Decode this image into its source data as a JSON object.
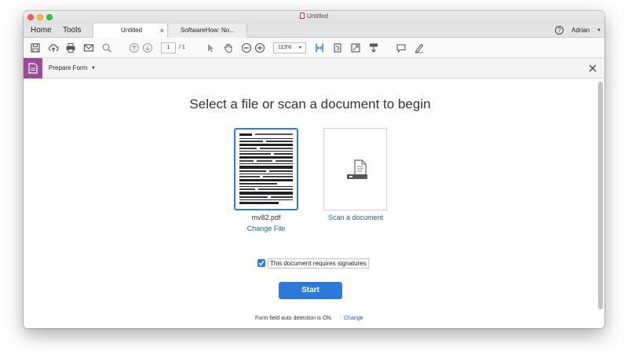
{
  "window": {
    "title": "Untitled"
  },
  "tabs": {
    "home_label": "Home",
    "tools_label": "Tools",
    "documents": [
      {
        "label": "Untitled",
        "close": "×"
      },
      {
        "label": "SoftwareHow: No..."
      }
    ]
  },
  "account": {
    "user_name": "Adrian",
    "help": "?"
  },
  "toolbar": {
    "page_current": "1",
    "page_total": "/ 1",
    "zoom": "113%"
  },
  "form_bar": {
    "label": "Prepare Form"
  },
  "main": {
    "heading": "Select a file or scan a document to begin",
    "file": {
      "name": "mv82.pdf",
      "change_label": "Change File"
    },
    "scan": {
      "label": "Scan a document"
    },
    "signature_checkbox": {
      "label": "This document requires signatures",
      "checked": true
    },
    "start_label": "Start",
    "auto_detect_text": "Form field auto detection is ON.",
    "auto_detect_change": "Change"
  },
  "colors": {
    "accent": "#2b7ad8",
    "link": "#1c61b0",
    "form_tool": "#9a4c9a"
  }
}
